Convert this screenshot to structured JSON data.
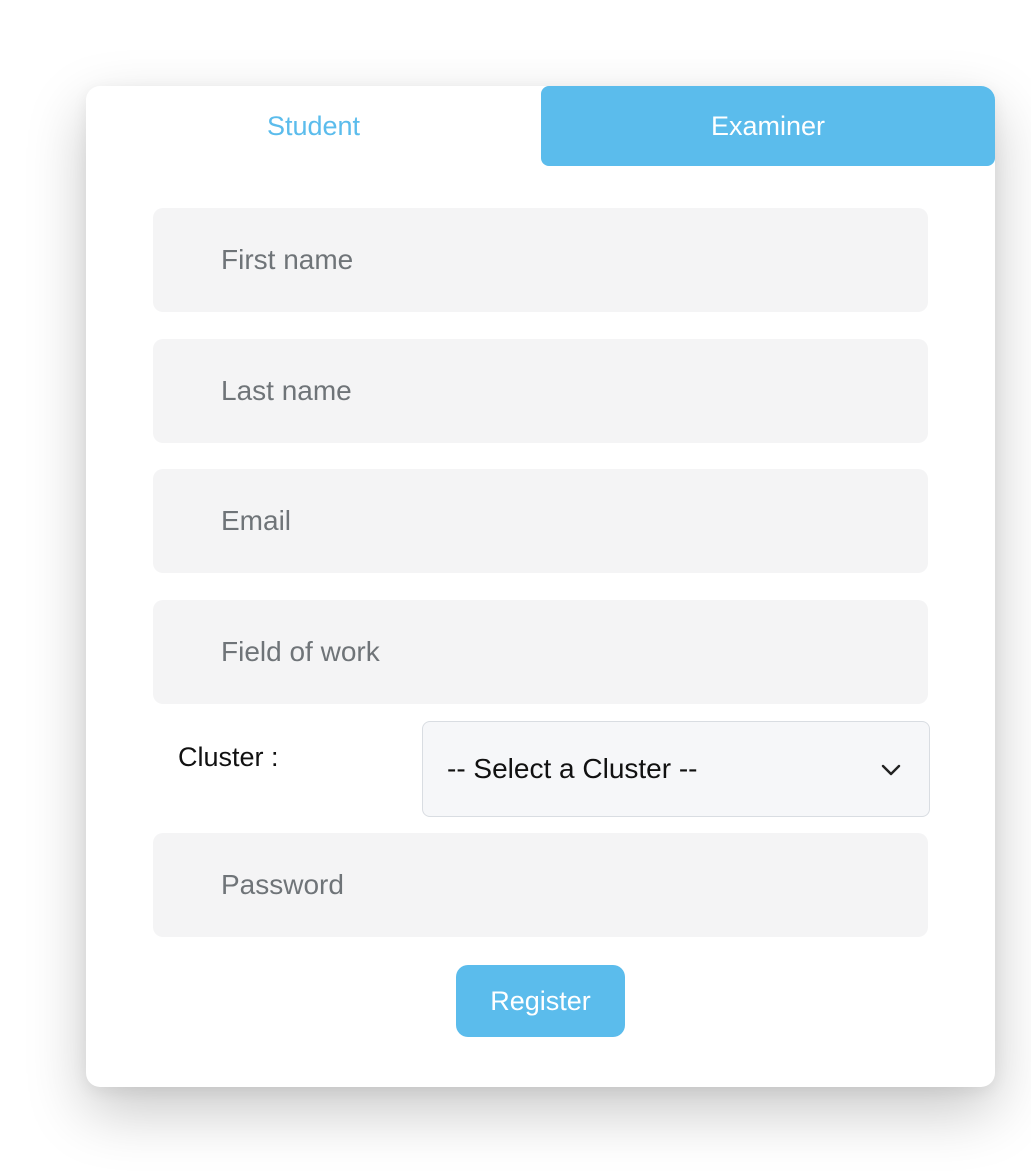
{
  "tabs": {
    "student": "Student",
    "examiner": "Examiner"
  },
  "form": {
    "first_name_placeholder": "First name",
    "last_name_placeholder": "Last name",
    "email_placeholder": "Email",
    "field_of_work_placeholder": "Field of work",
    "cluster_label": "Cluster :",
    "cluster_selected": "-- Select a Cluster --",
    "password_placeholder": "Password",
    "register_label": "Register"
  },
  "colors": {
    "accent": "#5bbcec",
    "input_background": "#f4f4f5",
    "placeholder_text": "#6f7478"
  },
  "icons": {
    "select_arrow": "chevron-down-icon"
  }
}
